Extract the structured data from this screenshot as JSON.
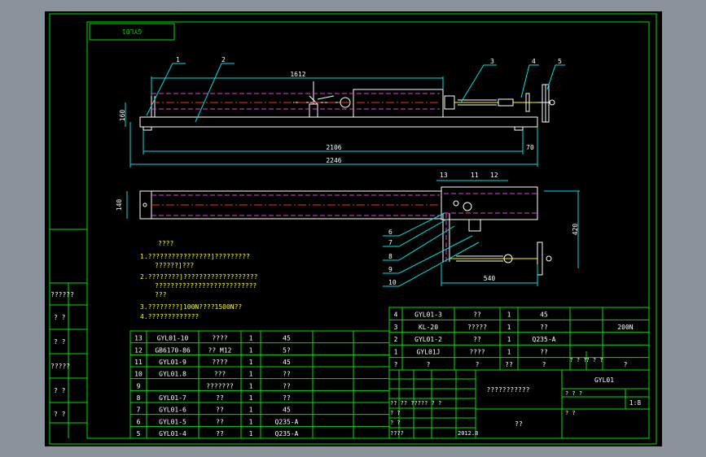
{
  "title_block_label": "GYL01",
  "dims": {
    "d1612": "1612",
    "d160": "160",
    "d2106": "2106",
    "d70": "70",
    "d2246": "2246",
    "d140": "140",
    "d420": "420",
    "d540": "540",
    "d200n": "200N"
  },
  "balloons_side": [
    "1",
    "2",
    "3",
    "4",
    "5"
  ],
  "balloons_top": [
    "13",
    "11",
    "12"
  ],
  "balloons_left": [
    "6",
    "7",
    "8",
    "9",
    "10"
  ],
  "notes": {
    "heading": "????",
    "n1": "1.????????????????]?????????",
    "n1b": "??????]???",
    "n2": "2.????????]???????????????????",
    "n2b": "??????????????????????????",
    "n2c": "???",
    "n3": "3.????????]100N????1500N??",
    "n4": "4.?????????????"
  },
  "left_strip": [
    "??????",
    "?  ?",
    "?  ?",
    "?????",
    "?  ?",
    "?  ?"
  ],
  "bom_left": [
    {
      "no": "13",
      "code": "GYL01-10",
      "name": "????",
      "qty": "1",
      "mat": "45"
    },
    {
      "no": "12",
      "code": "GB6170-86",
      "name": "?? M12",
      "qty": "1",
      "mat": "5?"
    },
    {
      "no": "11",
      "code": "GYL01-9",
      "name": "????",
      "qty": "1",
      "mat": "45"
    },
    {
      "no": "10",
      "code": "GYL01.8",
      "name": "???",
      "qty": "1",
      "mat": "??"
    },
    {
      "no": "9",
      "code": "",
      "name": "???????",
      "qty": "1",
      "mat": "??"
    },
    {
      "no": "8",
      "code": "GYL01-7",
      "name": "??",
      "qty": "1",
      "mat": "??"
    },
    {
      "no": "7",
      "code": "GYL01-6",
      "name": "??",
      "qty": "1",
      "mat": "45"
    },
    {
      "no": "6",
      "code": "GYL01-5",
      "name": "??",
      "qty": "1",
      "mat": "Q235-A"
    },
    {
      "no": "5",
      "code": "GYL01-4",
      "name": "??",
      "qty": "1",
      "mat": "Q235-A"
    }
  ],
  "bom_right": [
    {
      "no": "4",
      "code": "GYL01-3",
      "name": "??",
      "qty": "1",
      "mat": "45",
      "note": ""
    },
    {
      "no": "3",
      "code": "KL-20",
      "name": "?????",
      "qty": "1",
      "mat": "??",
      "note": "200N"
    },
    {
      "no": "2",
      "code": "GYL01-2",
      "name": "??",
      "qty": "1",
      "mat": "Q235-A",
      "note": ""
    },
    {
      "no": "1",
      "code": "GYL01J",
      "name": "????",
      "qty": "1",
      "mat": "??",
      "note": ""
    }
  ],
  "bom_header": {
    "no": "?",
    "code": "?",
    "name": "?",
    "qty": "??",
    "mat": "?",
    "m2": "? ? ?",
    "m3": "? ? ?",
    "note": "?"
  },
  "title_block": {
    "drawing_name": "???????????",
    "code": "GYL01",
    "company": "??",
    "scale_label": "1:8",
    "date": "2012.8",
    "row_a": "?? ??  ?????  ? ?",
    "row_b": "? ?",
    "row_c": "? ?",
    "row_d": "????",
    "mass": "? ? ?",
    "sheet": "?    ?"
  }
}
